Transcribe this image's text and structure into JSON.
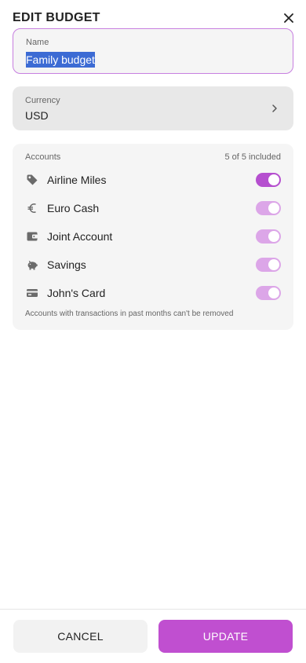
{
  "header": {
    "title": "EDIT BUDGET",
    "close_icon": "close-icon"
  },
  "name_field": {
    "label": "Name",
    "value": "Family budget"
  },
  "currency": {
    "label": "Currency",
    "value": "USD",
    "chevron_icon": "chevron-right-icon"
  },
  "accounts": {
    "label": "Accounts",
    "count_text": "5 of 5 included",
    "items": [
      {
        "label": "Airline Miles",
        "icon": "tag-icon",
        "included": true,
        "editable": true
      },
      {
        "label": "Euro Cash",
        "icon": "euro-icon",
        "included": true,
        "editable": false
      },
      {
        "label": "Joint Account",
        "icon": "wallet-icon",
        "included": true,
        "editable": false
      },
      {
        "label": "Savings",
        "icon": "piggy-bank-icon",
        "included": true,
        "editable": false
      },
      {
        "label": "John's Card",
        "icon": "credit-card-icon",
        "included": true,
        "editable": false
      }
    ],
    "note": "Accounts with transactions in past months can't be removed"
  },
  "footer": {
    "cancel_label": "CANCEL",
    "update_label": "UPDATE"
  },
  "colors": {
    "accent": "#c04fd0",
    "toggle_on": "#b54fcf",
    "toggle_disabled": "#dca6e8",
    "selection": "#3c6bd4"
  }
}
